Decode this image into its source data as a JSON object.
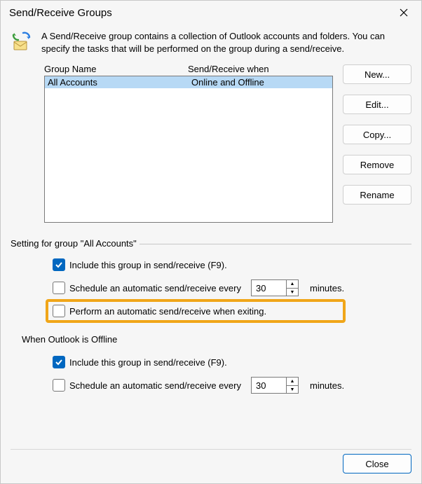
{
  "title": "Send/Receive Groups",
  "intro": "A Send/Receive group contains a collection of Outlook accounts and folders. You can specify the tasks that will be performed on the group during a send/receive.",
  "columns": {
    "name": "Group Name",
    "when": "Send/Receive when"
  },
  "groups": [
    {
      "name": "All Accounts",
      "when": "Online and Offline"
    }
  ],
  "buttons": {
    "new": "New...",
    "edit": "Edit...",
    "copy": "Copy...",
    "remove": "Remove",
    "rename": "Rename",
    "close": "Close"
  },
  "section_label": "Setting for group \"All Accounts\"",
  "opts": {
    "include": "Include this group in send/receive (F9).",
    "schedule": "Schedule an automatic send/receive every",
    "schedule_val": "30",
    "minutes": "minutes.",
    "perform_exit": "Perform an automatic send/receive when exiting."
  },
  "offline_header": "When Outlook is Offline",
  "offline": {
    "include": "Include this group in send/receive (F9).",
    "schedule": "Schedule an automatic send/receive every",
    "schedule_val": "30",
    "minutes": "minutes."
  }
}
